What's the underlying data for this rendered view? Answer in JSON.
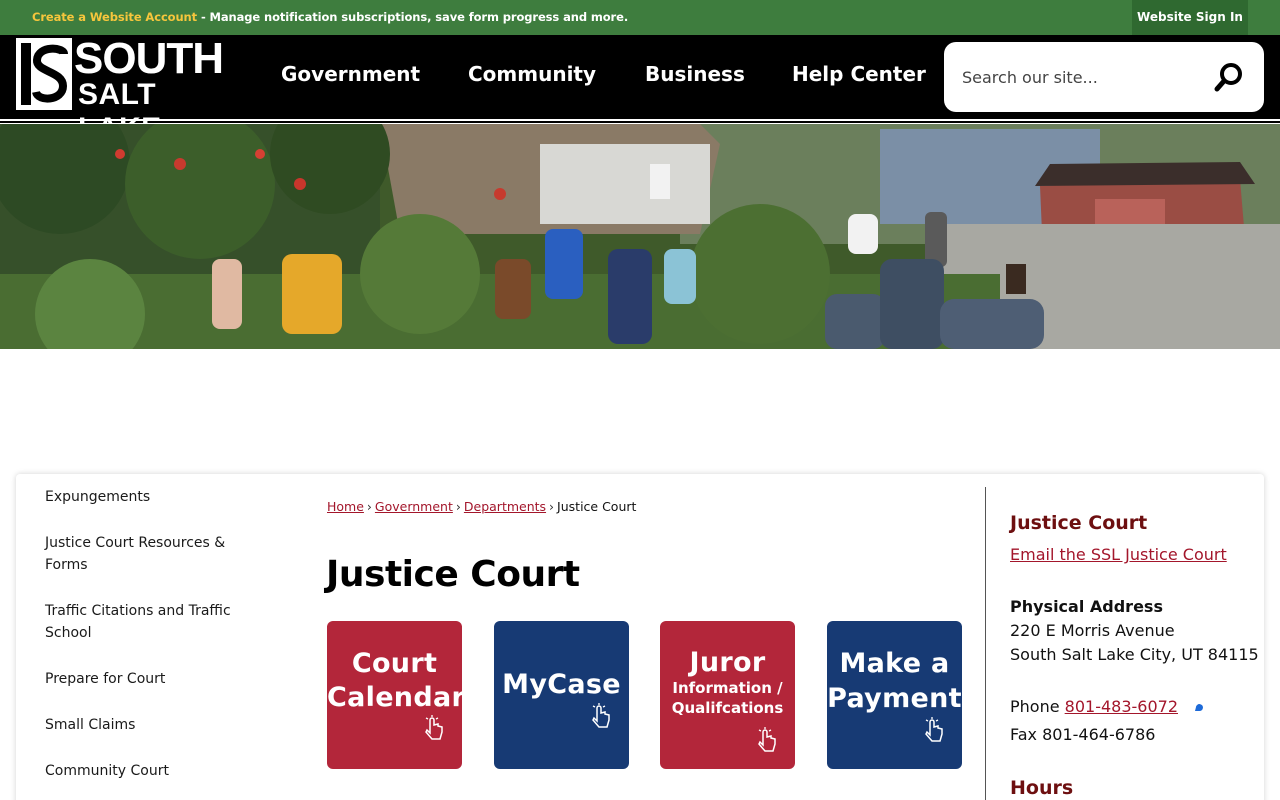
{
  "topbar": {
    "create_account": "Create a Website Account",
    "message": " - Manage notification subscriptions, save form progress and more.",
    "sign_in": "Website Sign In"
  },
  "logo": {
    "line1": "SOUTH",
    "line2": "SALT LAKE",
    "mark_letters": "S"
  },
  "nav": [
    "Government",
    "Community",
    "Business",
    "Help Center"
  ],
  "search": {
    "placeholder": "Search our site..."
  },
  "sidebar": {
    "items": [
      "Expungements",
      "Justice Court Resources & Forms",
      "Traffic Citations and Traffic School",
      "Prepare for Court",
      "Small Claims",
      "Community Court"
    ]
  },
  "breadcrumb": {
    "home": "Home",
    "government": "Government",
    "departments": "Departments",
    "current": "Justice Court"
  },
  "page_title": "Justice Court",
  "tiles": [
    {
      "line1": "Court",
      "line2": "Calendar",
      "color": "#b3263a"
    },
    {
      "line1": "MyCase",
      "color": "#173a74"
    },
    {
      "line1": "Juror",
      "line2": "Information /",
      "line3": "Qualifcations",
      "color": "#b3263a"
    },
    {
      "line1": "Make a",
      "line2": "Payment",
      "color": "#173a74"
    }
  ],
  "rail": {
    "heading": "Justice Court",
    "email_link": "Email the SSL Justice Court",
    "address_label": "Physical Address",
    "address_line1": "220 E Morris Avenue",
    "address_line2": "South Salt Lake City, UT 84115",
    "phone_label": "Phone ",
    "phone": "801-483-6072",
    "fax": "Fax 801-464-6786",
    "hours_heading": "Hours"
  },
  "colors": {
    "topbar_green": "#3e7d3e",
    "account_yellow": "#f6c63c",
    "link_red": "#a3162b",
    "heading_maroon": "#6d0f10",
    "tile_red": "#b3263a",
    "tile_blue": "#173a74"
  }
}
